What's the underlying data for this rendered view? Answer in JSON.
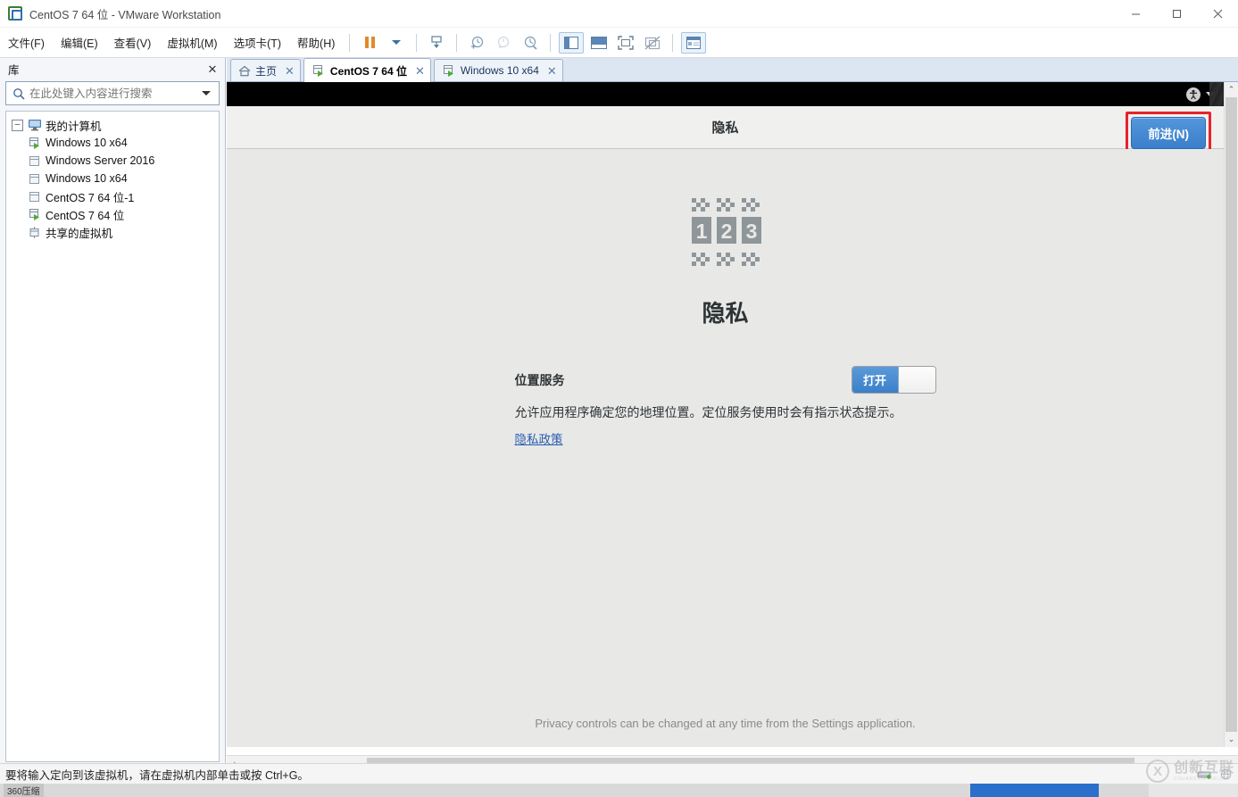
{
  "window": {
    "title": "CentOS 7 64 位 - VMware Workstation",
    "app_icon": "vmware-icon",
    "minimize": "–",
    "maximize": "▢",
    "close": "✕"
  },
  "menubar": {
    "items": [
      {
        "label": "文件(F)",
        "name": "menu-file"
      },
      {
        "label": "编辑(E)",
        "name": "menu-edit"
      },
      {
        "label": "查看(V)",
        "name": "menu-view"
      },
      {
        "label": "虚拟机(M)",
        "name": "menu-vm"
      },
      {
        "label": "选项卡(T)",
        "name": "menu-tabs"
      },
      {
        "label": "帮助(H)",
        "name": "menu-help"
      }
    ],
    "toolbar_icons": [
      "pause-icon",
      "power-dropdown-icon",
      "send-ctrl-alt-del-icon",
      "take-snapshot-icon",
      "revert-snapshot-icon",
      "snapshot-manager-icon",
      "show-library-icon",
      "show-thumbnail-bar-icon",
      "full-screen-icon",
      "unity-mode-icon",
      "console-view-icon"
    ]
  },
  "library": {
    "title": "库",
    "close_label": "✕",
    "search": {
      "placeholder": "在此处键入内容进行搜索",
      "value": "",
      "icon": "search-icon"
    },
    "tree": [
      {
        "label": "我的计算机",
        "icon": "my-computer-icon",
        "level": 0,
        "expanded": true,
        "expander": "–"
      },
      {
        "label": "Windows 10 x64",
        "icon": "vm-running-icon",
        "level": 1,
        "running": true
      },
      {
        "label": "Windows Server 2016",
        "icon": "vm-icon",
        "level": 1,
        "running": false
      },
      {
        "label": "Windows 10 x64",
        "icon": "vm-icon",
        "level": 1,
        "running": false
      },
      {
        "label": "CentOS 7 64 位-1",
        "icon": "vm-icon",
        "level": 1,
        "running": false
      },
      {
        "label": "CentOS 7 64 位",
        "icon": "vm-running-icon",
        "level": 1,
        "running": true
      },
      {
        "label": "共享的虚拟机",
        "icon": "shared-vms-icon",
        "level": 0,
        "expanded": false
      }
    ]
  },
  "tabs": [
    {
      "label": "主页",
      "icon": "home-icon",
      "active": false,
      "close": "✕"
    },
    {
      "label": "CentOS 7 64 位",
      "icon": "vm-running-icon",
      "active": true,
      "close": "✕"
    },
    {
      "label": "Windows 10 x64",
      "icon": "vm-running-icon",
      "active": false,
      "close": "✕"
    }
  ],
  "guest": {
    "topbar": {
      "accessibility_icon": "accessibility-icon",
      "menu_caret": "chevron-down-icon"
    },
    "header": {
      "title": "隐私",
      "forward_button": "前进(N)",
      "highlight_color": "#e8232a"
    },
    "content": {
      "icon": "privacy-123-icon",
      "title": "隐私",
      "setting_label": "位置服务",
      "toggle": {
        "state_label": "打开",
        "on": true,
        "accent": "#3a80c9"
      },
      "description": "允许应用程序确定您的地理位置。定位服务使用时会有指示状态提示。",
      "link": "隐私政策"
    },
    "footer": "Privacy controls can be changed at any time from the Settings application."
  },
  "scrollbars": {
    "v_up": "⌃",
    "v_down": "⌄",
    "h_left": "‹",
    "h_right": "›"
  },
  "statusbar": {
    "message": "要将输入定向到该虚拟机，请在虚拟机内部单击或按 Ctrl+G。",
    "icons": [
      "hard-disk-icon",
      "network-icon"
    ]
  },
  "watermark": {
    "mark": "X",
    "name": "创新互联",
    "subtitle": "CHUANGXIN HULIAN"
  },
  "taskbar": {
    "app_label": "360压缩"
  }
}
